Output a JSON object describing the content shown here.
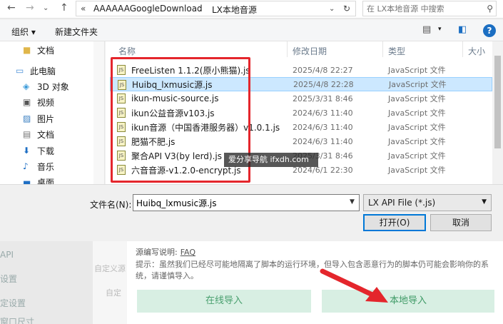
{
  "addressbar": {
    "chevrons": "«",
    "path": [
      "AAAAAAGoogleDownload",
      "LX本地音源"
    ],
    "separator": "›",
    "search_placeholder": "在 LX本地音源 中搜索"
  },
  "toolbar": {
    "organize": "组织 ▾",
    "new_folder": "新建文件夹",
    "help": "?"
  },
  "navpane": {
    "items": [
      {
        "label": "文档",
        "icon": "folder-icon"
      },
      {
        "label": "此电脑",
        "icon": "computer-icon"
      },
      {
        "label": "3D 对象",
        "icon": "3d-objects-icon"
      },
      {
        "label": "视频",
        "icon": "video-icon"
      },
      {
        "label": "图片",
        "icon": "pictures-icon"
      },
      {
        "label": "文档",
        "icon": "documents-icon"
      },
      {
        "label": "下载",
        "icon": "download-icon"
      },
      {
        "label": "音乐",
        "icon": "music-icon"
      },
      {
        "label": "桌面",
        "icon": "desktop-icon"
      }
    ]
  },
  "filelist": {
    "columns": {
      "name": "名称",
      "modified": "修改日期",
      "type": "类型",
      "size": "大小"
    },
    "rows": [
      {
        "name": "FreeListen 1.1.2(原小熊猫).js",
        "date": "2025/4/8 22:27",
        "type": "JavaScript 文件",
        "selected": false
      },
      {
        "name": "Huibq_lxmusic源.js",
        "date": "2025/4/8 22:28",
        "type": "JavaScript 文件",
        "selected": true
      },
      {
        "name": "ikun-music-source.js",
        "date": "2025/3/31 8:46",
        "type": "JavaScript 文件",
        "selected": false
      },
      {
        "name": "ikun公益音源v103.js",
        "date": "2024/6/3 11:40",
        "type": "JavaScript 文件",
        "selected": false
      },
      {
        "name": "ikun音源（中国香港服务器）v1.0.1.js",
        "date": "2024/6/3 11:40",
        "type": "JavaScript 文件",
        "selected": false
      },
      {
        "name": "肥猫不肥.js",
        "date": "2024/6/3 11:40",
        "type": "JavaScript 文件",
        "selected": false
      },
      {
        "name": "聚合API V3(by lerd).js",
        "date": "2025/3/31 8:46",
        "type": "JavaScript 文件",
        "selected": false
      },
      {
        "name": "六音音源-v1.2.0-encrypt.js",
        "date": "2024/6/1 22:30",
        "type": "JavaScript 文件",
        "selected": false
      }
    ]
  },
  "watermark": "爱分享导航 ifxdh.com",
  "dialog_bottom": {
    "filename_label": "文件名(N):",
    "filename_value": "Huibq_lxmusic源.js",
    "filetype": "LX API File (*.js)",
    "open_label": "打开(O)",
    "cancel_label": "取消"
  },
  "app": {
    "source_label": "源编写说明:",
    "faq": "FAQ",
    "hint": "提示：虽然我们已经尽可能地隔离了脚本的运行环境，但导入包含恶意行为的脚本仍可能会影响你的系统，请谨慎导入。",
    "online_import": "在线导入",
    "local_import": "本地导入",
    "side_items": [
      "API",
      "设置",
      "定设置",
      "窗口尺寸"
    ],
    "mid_items": [
      "自定义源",
      "自定"
    ]
  },
  "colors": {
    "highlight_box": "#e4262c",
    "selection": "#cce8ff",
    "import_button_bg": "#d8efe3",
    "import_button_text": "#3e9a66"
  }
}
